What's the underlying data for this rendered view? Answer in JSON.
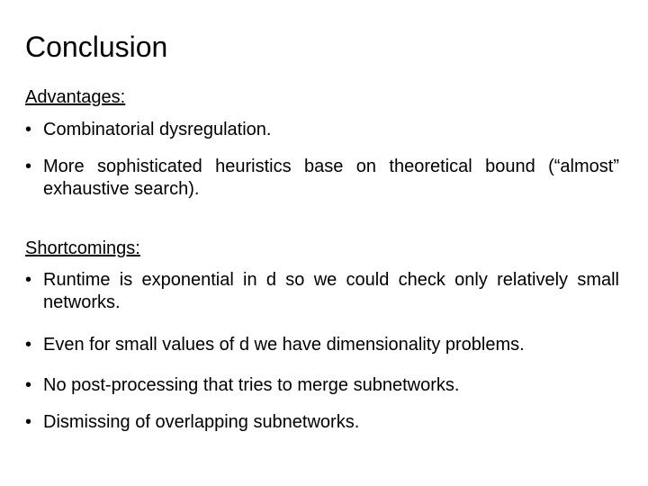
{
  "title": "Conclusion",
  "advantages": {
    "heading": "Advantages:",
    "items": [
      "Combinatorial dysregulation.",
      "More sophisticated heuristics base on theoretical bound (“almost” exhaustive search)."
    ]
  },
  "shortcomings": {
    "heading": "Shortcomings:",
    "items": [
      "Runtime is exponential in d so we could check only relatively small networks.",
      "Even for small values of d we have dimensionality problems.",
      "No post-processing that tries to merge subnetworks.",
      "Dismissing of overlapping subnetworks."
    ]
  },
  "bullet_glyph": "•"
}
